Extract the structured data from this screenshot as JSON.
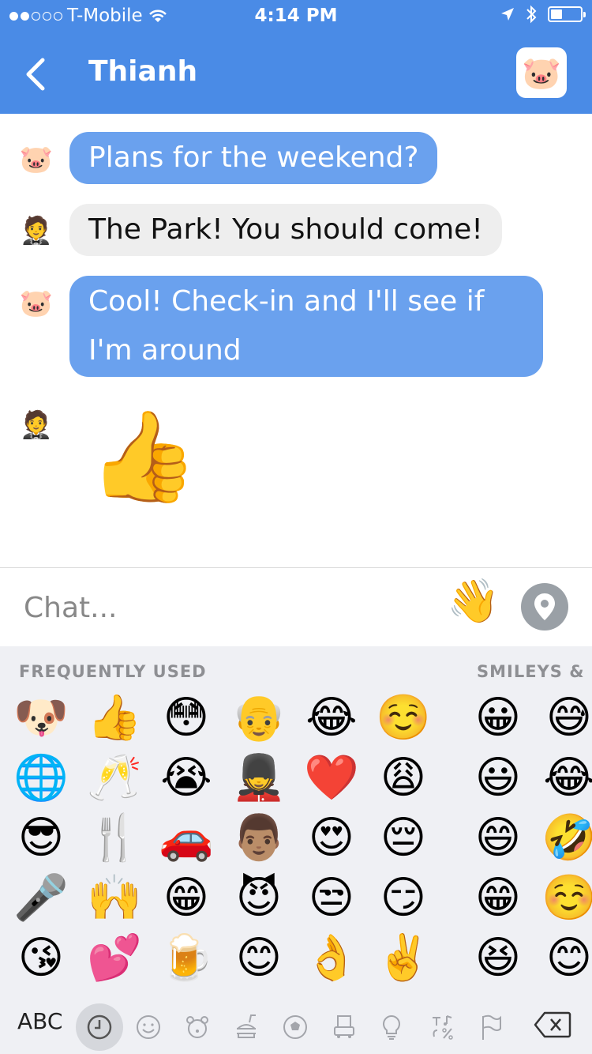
{
  "status_bar": {
    "carrier": "T-Mobile",
    "time": "4:14 PM"
  },
  "header": {
    "back_label": "",
    "title": "Thianh",
    "avatar": "🐷"
  },
  "messages": [
    {
      "avatar": "🐷",
      "text": "Plans for the weekend?"
    },
    {
      "avatar": "🤵",
      "text": "The Park! You should come!"
    },
    {
      "avatar": "🐷",
      "text": "Cool! Check-in and I'll see if I'm around"
    },
    {
      "avatar": "🤵",
      "emoji": "👍"
    }
  ],
  "input": {
    "placeholder": "Chat...",
    "wave": "👋"
  },
  "keyboard": {
    "section_frequent": "FREQUENTLY USED",
    "section_smileys": "SMILEYS & P",
    "frequent_columns": [
      [
        "🐶",
        "🌐",
        "😎",
        "🎤",
        "😘"
      ],
      [
        "👍",
        "🥂",
        "🍴",
        "🙌",
        "💕"
      ],
      [
        "😳",
        "😭",
        "🚗",
        "😁",
        "🍺"
      ],
      [
        "👴",
        "💂",
        "👨🏽",
        "😈",
        "😊"
      ],
      [
        "😂",
        "❤️",
        "😍",
        "😒",
        "👌"
      ],
      [
        "☺️",
        "😩",
        "😔",
        "😏",
        "✌️"
      ]
    ],
    "smiley_columns": [
      [
        "😀",
        "😃",
        "😄",
        "😁",
        "😆"
      ],
      [
        "😅",
        "😂",
        "🤣",
        "☺️",
        "😊"
      ]
    ],
    "abc_label": "ABC"
  }
}
